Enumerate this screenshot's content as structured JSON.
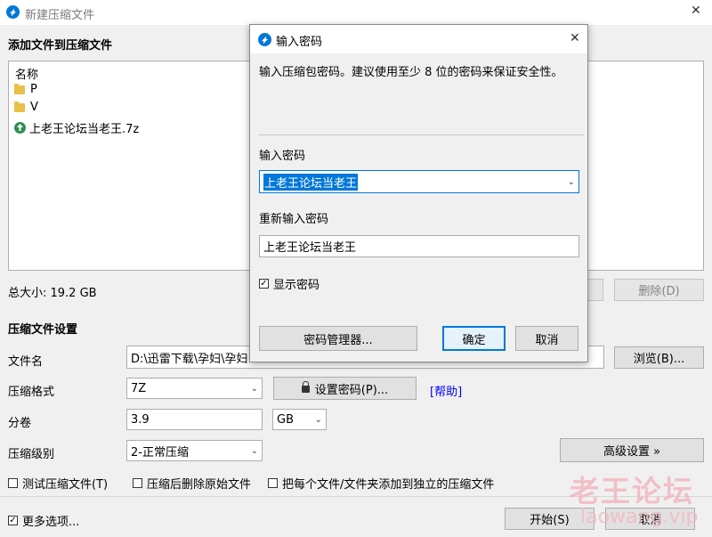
{
  "main_window": {
    "title": "新建压缩文件",
    "close_glyph": "✕",
    "section_add": "添加文件到压缩文件",
    "list_header": "名称",
    "files": [
      {
        "name": "P",
        "icon": "folder-icon"
      },
      {
        "name": "V",
        "icon": "folder-icon"
      },
      {
        "name": "上老王论坛当老王.7z",
        "icon": "archive-icon"
      }
    ],
    "total_size": "总大小: 19.2 GB",
    "delete_button": "删除(D)",
    "section_settings": "压缩文件设置",
    "filename_label": "文件名",
    "filename_value": "D:\\迅雷下载\\孕妇\\孕妇",
    "browse_button": "浏览(B)...",
    "format_label": "压缩格式",
    "format_value": "7Z",
    "set_password_button": "设置密码(P)...",
    "help_link": "[帮助]",
    "volume_label": "分卷",
    "volume_value": "3.9",
    "volume_unit": "GB",
    "level_label": "压缩级别",
    "level_value": "2-正常压缩",
    "advanced_button": "高级设置 »",
    "test_checkbox": "测试压缩文件(T)",
    "delete_after_checkbox": "压缩后删除原始文件",
    "separate_checkbox": "把每个文件/文件夹添加到独立的压缩文件",
    "more_options_checkbox": "更多选项...",
    "more_options_checked": true,
    "start_button": "开始(S)",
    "cancel_button": "取消"
  },
  "dialog": {
    "title": "输入密码",
    "close_glyph": "✕",
    "description": "输入压缩包密码。建议使用至少 8 位的密码来保证安全性。",
    "password_label": "输入密码",
    "password_value": "上老王论坛当老王",
    "confirm_label": "重新输入密码",
    "confirm_value": "上老王论坛当老王",
    "show_password": "显示密码",
    "show_password_checked": true,
    "manager_button": "密码管理器...",
    "ok_button": "确定",
    "cancel_button": "取消"
  },
  "watermark": {
    "text": "老王论坛",
    "url": "laowang.vip"
  },
  "colors": {
    "accent": "#0078d7",
    "link": "#0000ff",
    "watermark": "#f2b8c0"
  }
}
